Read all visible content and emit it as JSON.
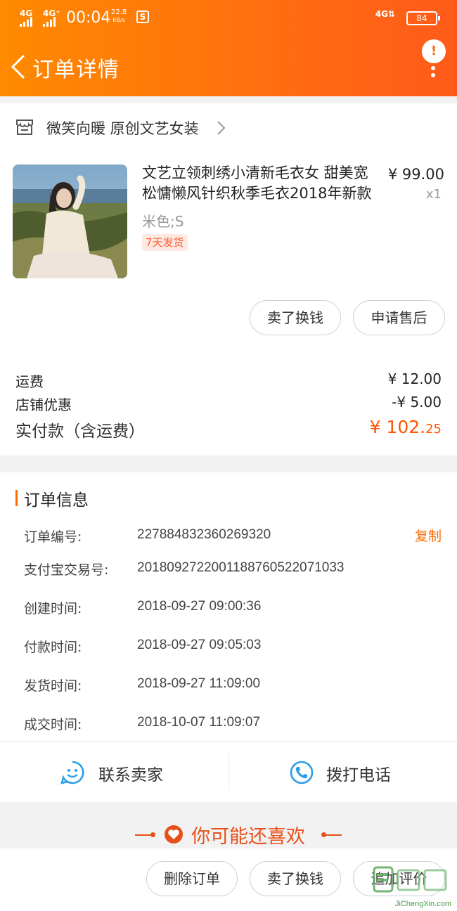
{
  "status_bar": {
    "signal_1": "4G",
    "signal_2": "4G⁺",
    "time": "00:04",
    "net_speed_value": "22.8",
    "net_speed_unit": "KB/s",
    "app_icon_letter": "S",
    "network": "4G⇅",
    "battery": "84"
  },
  "header": {
    "title": "订单详情",
    "message_badge": "!"
  },
  "store": {
    "name": "微笑向暖 原创文艺女装"
  },
  "product": {
    "title": "文艺立领刺绣小清新毛衣女 甜美宽松慵懒风针织秋季毛衣2018年新款",
    "price": "¥ 99.00",
    "quantity": "x1",
    "sku": "米色;S",
    "tag": "7天发货",
    "actions": {
      "sell": "卖了换钱",
      "after_sale": "申请售后"
    }
  },
  "costs": {
    "shipping_label": "运费",
    "shipping_value": "¥ 12.00",
    "discount_label": "店铺优惠",
    "discount_value": "-¥ 5.00",
    "paid_label": "实付款（含运费）",
    "paid_value_int": "¥ 102.",
    "paid_value_dec": "25"
  },
  "order_info": {
    "title": "订单信息",
    "copy_label": "复制",
    "rows": [
      {
        "label": "订单编号:",
        "value": "227884832360269320"
      },
      {
        "label": "支付宝交易号:",
        "value": "2018092722001188760522071033"
      },
      {
        "label": "创建时间:",
        "value": "2018-09-27 09:00:36"
      },
      {
        "label": "付款时间:",
        "value": "2018-09-27 09:05:03"
      },
      {
        "label": "发货时间:",
        "value": "2018-09-27 11:09:00"
      },
      {
        "label": "成交时间:",
        "value": "2018-10-07 11:09:07"
      }
    ]
  },
  "contact": {
    "seller": "联系卖家",
    "phone": "拨打电话"
  },
  "recommend": {
    "title": "你可能还喜欢"
  },
  "bottom_actions": {
    "delete": "删除订单",
    "sell": "卖了换钱",
    "review": "追加评价"
  },
  "watermark": {
    "site": "JiChengXin.com"
  },
  "colors": {
    "header_start": "#ff8a00",
    "header_end": "#ff5a1a",
    "accent": "#ff6a00",
    "price_red": "#ff5500",
    "icon_blue": "#2a9ee8"
  }
}
